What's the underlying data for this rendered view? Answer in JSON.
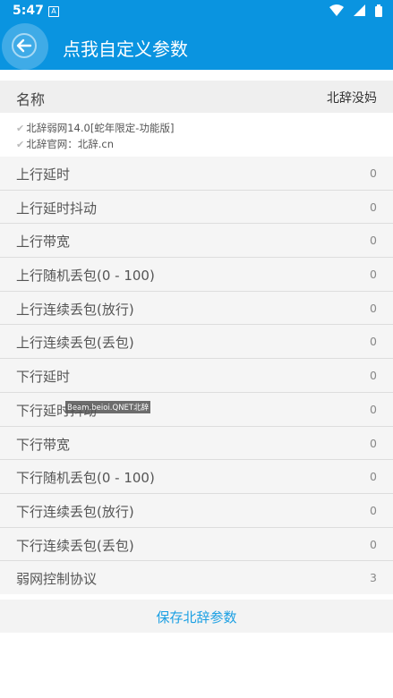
{
  "status_bar": {
    "time": "5:47",
    "notification_glyph": "A",
    "icons": [
      "wifi-icon",
      "signal-icon",
      "battery-icon"
    ]
  },
  "app_bar": {
    "title": "点我自定义参数",
    "back_icon": "arrow-left-icon",
    "color": "#0a94e0"
  },
  "name_row": {
    "label": "名称",
    "value": "北辞没妈"
  },
  "info": {
    "line1": "北辞弱网14.0[蛇年限定-功能版]",
    "line2": "北辞官网：北辞.cn"
  },
  "params": [
    {
      "label": "上行延时",
      "value": "0"
    },
    {
      "label": "上行延时抖动",
      "value": "0"
    },
    {
      "label": "上行带宽",
      "value": "0"
    },
    {
      "label": "上行随机丢包(0 - 100)",
      "value": "0"
    },
    {
      "label": "上行连续丢包(放行)",
      "value": "0"
    },
    {
      "label": "上行连续丢包(丢包)",
      "value": "0"
    },
    {
      "label": "下行延时",
      "value": "0"
    },
    {
      "label": "下行延时抖动",
      "value": "0"
    },
    {
      "label": "下行带宽",
      "value": "0"
    },
    {
      "label": "下行随机丢包(0 - 100)",
      "value": "0"
    },
    {
      "label": "下行连续丢包(放行)",
      "value": "0"
    },
    {
      "label": "下行连续丢包(丢包)",
      "value": "0"
    },
    {
      "label": "弱网控制协议",
      "value": "3"
    }
  ],
  "watermark": "Beam.beioi.QNET北辞",
  "save_button": "保存北辞参数",
  "accent_color": "#1a9fe3"
}
